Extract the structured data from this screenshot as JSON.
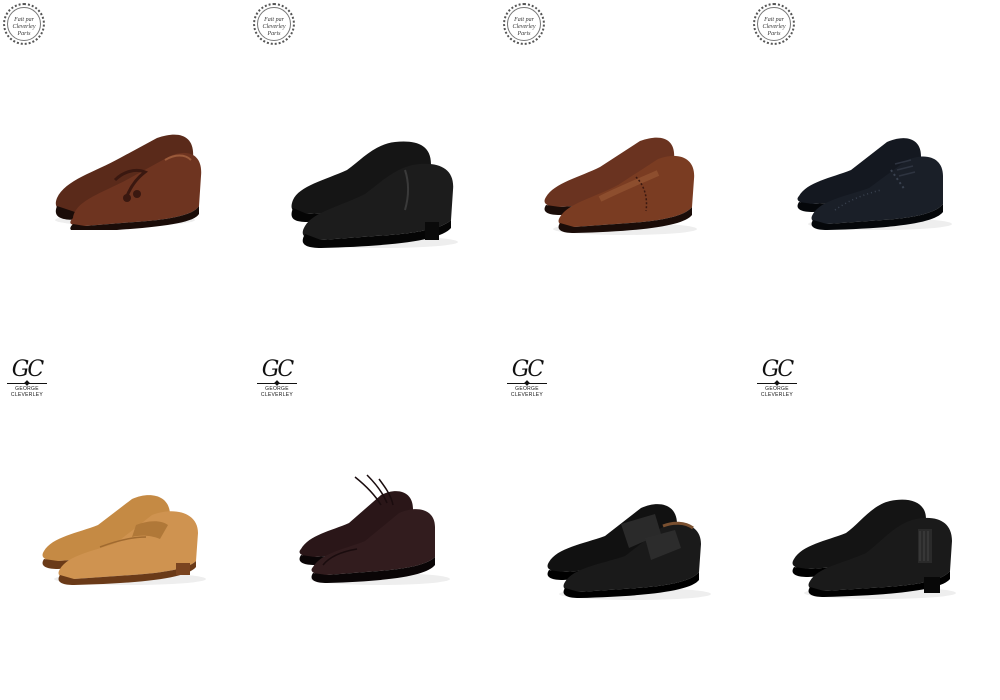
{
  "products": [
    {
      "brand_logo": "seal",
      "seal_text": "Fait par Cleverley Paris",
      "style": "tassel loafer",
      "color": "#5a2a1a",
      "accent": "#8a4a2a"
    },
    {
      "brand_logo": "seal",
      "seal_text": "Fait par Cleverley Paris",
      "style": "side gusset slip-on",
      "color": "#151515",
      "accent": "#3a3a3a"
    },
    {
      "brand_logo": "seal",
      "seal_text": "Fait par Cleverley Paris",
      "style": "adelaide slip-on",
      "color": "#6a3320",
      "accent": "#a0603a"
    },
    {
      "brand_logo": "seal",
      "seal_text": "Fait par Cleverley Paris",
      "style": "brogue oxford",
      "color": "#141820",
      "accent": "#2e3440"
    },
    {
      "brand_logo": "gc",
      "monogram": "GC",
      "wordmark": "GEORGE CLEVERLEY",
      "style": "suede penny loafer",
      "color": "#c58a44",
      "accent": "#e0ad6a"
    },
    {
      "brand_logo": "gc",
      "monogram": "GC",
      "wordmark": "GEORGE CLEVERLEY",
      "style": "cap-toe oxford",
      "color": "#2a1618",
      "accent": "#4a3034"
    },
    {
      "brand_logo": "gc",
      "monogram": "GC",
      "wordmark": "GEORGE CLEVERLEY",
      "style": "strap loafer",
      "color": "#111111",
      "accent": "#333333"
    },
    {
      "brand_logo": "gc",
      "monogram": "GC",
      "wordmark": "GEORGE CLEVERLEY",
      "style": "chelsea slip-on",
      "color": "#141414",
      "accent": "#383838"
    }
  ]
}
